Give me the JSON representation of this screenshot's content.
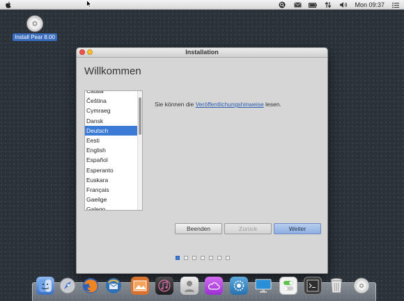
{
  "menubar": {
    "clock": "Mon 09:37"
  },
  "desktop": {
    "icon_label": "Install Pear 8.00"
  },
  "window": {
    "title": "Installation",
    "heading": "Willkommen",
    "languages": [
      "Català",
      "Čeština",
      "Cymraeg",
      "Dansk",
      "Deutsch",
      "Eesti",
      "English",
      "Español",
      "Esperanto",
      "Euskara",
      "Français",
      "Gaeilge",
      "Galego"
    ],
    "selected_language": "Deutsch",
    "notes": {
      "prefix": "Sie können die ",
      "link": "Veröffentlichungshinweise",
      "suffix": " lesen."
    },
    "buttons": {
      "quit": "Beenden",
      "back": "Zurück",
      "next": "Weiter"
    },
    "progress": {
      "current_step": 1,
      "total_steps": 7
    }
  },
  "dock": {
    "icons": [
      "finder-icon",
      "launchpad-icon",
      "firefox-icon",
      "thunderbird-icon",
      "photos-icon",
      "music-icon",
      "contacts-icon",
      "cloud-icon",
      "settings-icon",
      "display-icon",
      "switch-icon",
      "terminal-icon",
      "trash-icon",
      "disc-icon"
    ]
  },
  "colors": {
    "selection": "#3b7bd6",
    "link": "#2a5db0"
  }
}
